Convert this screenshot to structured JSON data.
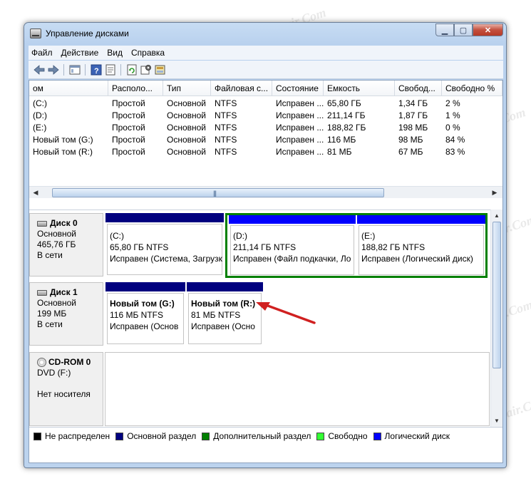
{
  "window": {
    "title": "Управление дисками",
    "controls": {
      "minimize": "▁",
      "maximize": "▢",
      "close": "✕"
    }
  },
  "menu": [
    "Файл",
    "Действие",
    "Вид",
    "Справка"
  ],
  "toolbar": [
    "back-icon",
    "forward-icon",
    "console-tree-icon",
    "help-icon",
    "refresh-icon",
    "properties-icon",
    "settings-icon"
  ],
  "volumes": {
    "columns": [
      "ом",
      "Располо...",
      "Тип",
      "Файловая с...",
      "Состояние",
      "Емкость",
      "Свобод...",
      "Свободно %"
    ],
    "rows": [
      [
        "(C:)",
        "Простой",
        "Основной",
        "NTFS",
        "Исправен ...",
        "65,80 ГБ",
        "1,34 ГБ",
        "2 %"
      ],
      [
        "(D:)",
        "Простой",
        "Основной",
        "NTFS",
        "Исправен ...",
        "211,14 ГБ",
        "1,87 ГБ",
        "1 %"
      ],
      [
        "(E:)",
        "Простой",
        "Основной",
        "NTFS",
        "Исправен ...",
        "188,82 ГБ",
        "198 МБ",
        "0 %"
      ],
      [
        "Новый том (G:)",
        "Простой",
        "Основной",
        "NTFS",
        "Исправен ...",
        "116 МБ",
        "98 МБ",
        "84 %"
      ],
      [
        "Новый том (R:)",
        "Простой",
        "Основной",
        "NTFS",
        "Исправен ...",
        "81 МБ",
        "67 МБ",
        "83 %"
      ]
    ]
  },
  "disks": [
    {
      "name": "Диск 0",
      "type": "Основной",
      "size": "465,76 ГБ",
      "status": "В сети"
    },
    {
      "name": "Диск 1",
      "type": "Основной",
      "size": "199 МБ",
      "status": "В сети"
    },
    {
      "name": "CD-ROM 0",
      "type": "DVD (F:)",
      "size": "",
      "status": "Нет носителя"
    }
  ],
  "partitions": {
    "c": {
      "name": "(C:)",
      "size": "65,80 ГБ NTFS",
      "status": "Исправен (Система, Загрузк"
    },
    "d": {
      "name": "(D:)",
      "size": "211,14 ГБ NTFS",
      "status": "Исправен (Файл подкачки, Ло"
    },
    "e": {
      "name": "(E:)",
      "size": "188,82 ГБ NTFS",
      "status": "Исправен (Логический диск)"
    },
    "g": {
      "name": "Новый том  (G:)",
      "size": "116 МБ NTFS",
      "status": "Исправен (Основ"
    },
    "r": {
      "name": "Новый том  (R:)",
      "size": "81 МБ NTFS",
      "status": "Исправен (Осно"
    }
  },
  "legend": [
    {
      "label": "Не распределен",
      "color": "#000000"
    },
    {
      "label": "Основной раздел",
      "color": "#000080"
    },
    {
      "label": "Дополнительный раздел",
      "color": "#008000"
    },
    {
      "label": "Свободно",
      "color": "#33ff33"
    },
    {
      "label": "Логический диск",
      "color": "#0000ff"
    }
  ],
  "colors": {
    "primary": "#00007f",
    "logical": "#0000ff",
    "extended": "#008000"
  },
  "watermark": "Soringpcrepair.Com"
}
